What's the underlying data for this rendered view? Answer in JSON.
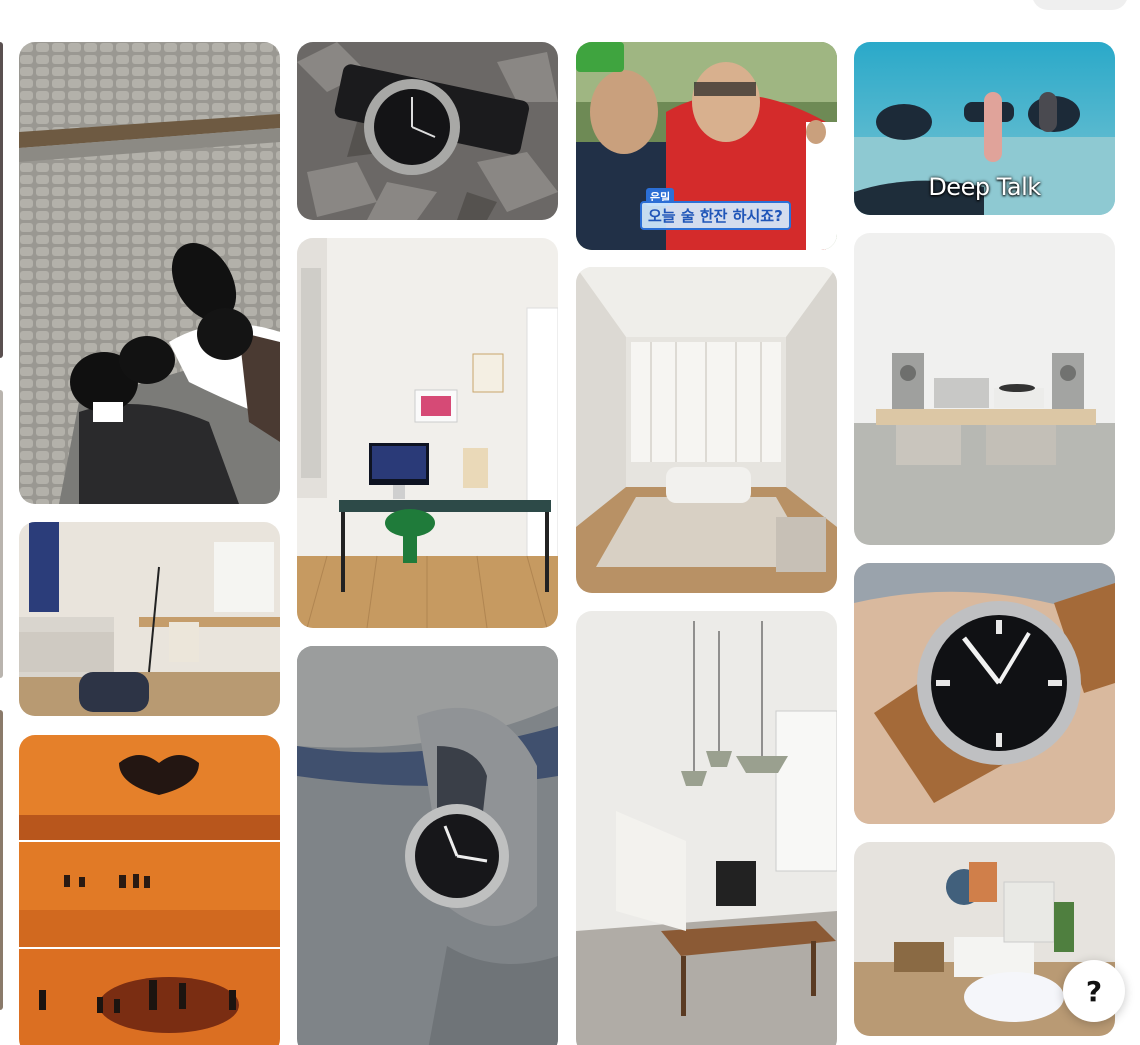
{
  "pins": {
    "underwater_caption": "Deep Talk",
    "variety_tag": "은밀",
    "variety_caption": "오늘 술 한잔 하시죠?"
  },
  "help_button": {
    "label": "?"
  },
  "colors": {
    "background": "#ffffff",
    "help_button_bg": "#ffffff",
    "top_pill": "#efefef"
  }
}
